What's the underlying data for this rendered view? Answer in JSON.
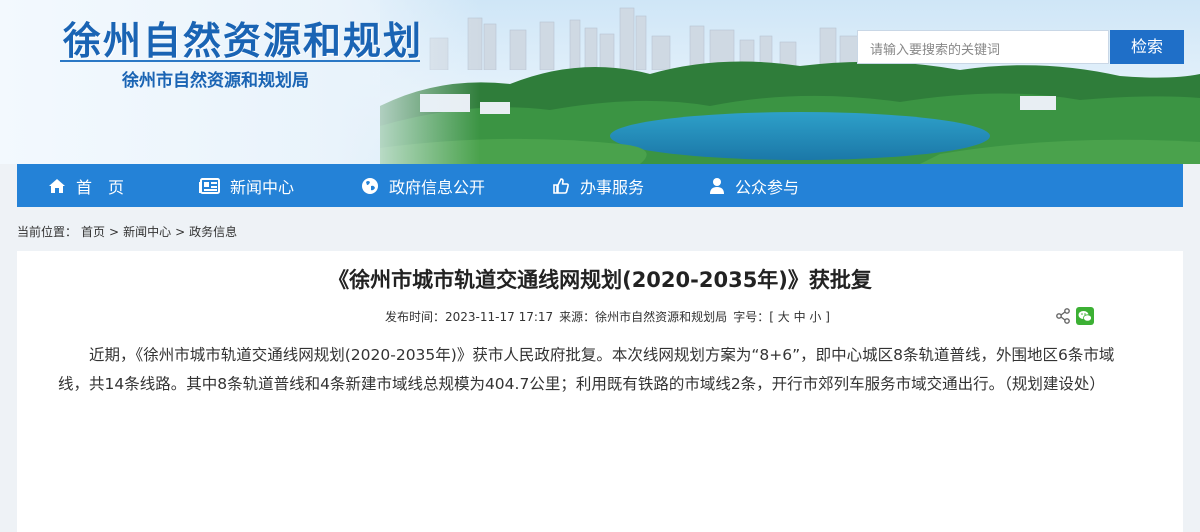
{
  "header": {
    "site_title": "徐州自然资源和规划",
    "site_subtitle": "徐州市自然资源和规划局",
    "search_placeholder": "请输入要搜索的关键词",
    "search_button": "检索"
  },
  "nav": [
    {
      "label": "首　页",
      "icon": "home-icon"
    },
    {
      "label": "新闻中心",
      "icon": "newspaper-icon"
    },
    {
      "label": "政府信息公开",
      "icon": "globe-icon"
    },
    {
      "label": "办事服务",
      "icon": "thumbs-up-icon"
    },
    {
      "label": "公众参与",
      "icon": "user-icon"
    }
  ],
  "breadcrumb": {
    "prefix": "当前位置：",
    "items": [
      "首页",
      "新闻中心",
      "政务信息"
    ],
    "separator": ">"
  },
  "article": {
    "title": "《徐州市城市轨道交通线网规划(2020-2035年)》获批复",
    "publish_label": "发布时间：",
    "publish_time": "2023-11-17 17:17",
    "source_label": "来源：",
    "source": "徐州市自然资源和规划局",
    "font_label": "字号：",
    "font_open": "[",
    "font_large": "大",
    "font_medium": "中",
    "font_small": "小",
    "font_close": "]",
    "body": "近期，《徐州市城市轨道交通线网规划(2020-2035年)》获市人民政府批复。本次线网规划方案为“8+6”，即中心城区8条轨道普线，外围地区6条市域线，共14条线路。其中8条轨道普线和4条新建市域线总规模为404.7公里；利用既有铁路的市域线2条，开行市郊列车服务市域交通出行。（规划建设处）"
  },
  "colors": {
    "brand_blue": "#1a64b4",
    "nav_blue": "#2482d7",
    "button_blue": "#1f6fc8",
    "wechat_green": "#3cb034"
  }
}
